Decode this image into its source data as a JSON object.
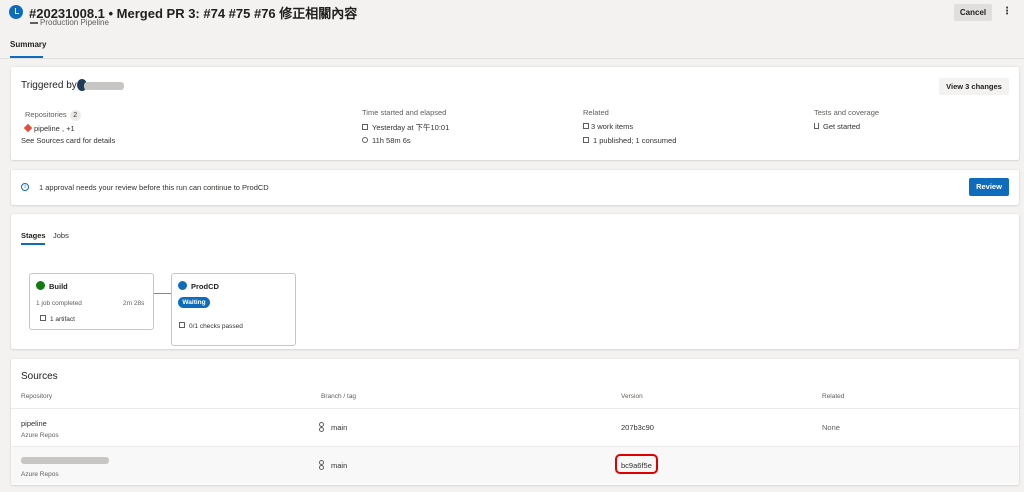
{
  "header": {
    "run_title": "#20231008.1 • Merged PR 3: #74 #75 #76 修正相關內容",
    "pipeline_name": "Production Pipeline",
    "cancel_label": "Cancel",
    "more_label": "⋮"
  },
  "tabs": {
    "summary": "Summary"
  },
  "summary_card": {
    "triggered_by_label": "Triggered by",
    "view_changes_label": "View 3 changes",
    "repositories_label": "Repositories",
    "repositories_count": "2",
    "repository_value": "pipeline",
    "repository_more": ", +1",
    "sources_link": "See Sources card for details",
    "time_label": "Time started and elapsed",
    "time_started": "Yesterday at 下午10:01",
    "elapsed": "11h 58m 6s",
    "related_label": "Related",
    "work_items": "3 work items",
    "published": "1 published; 1 consumed",
    "tests_label": "Tests and coverage",
    "get_started": "Get started"
  },
  "approval_banner": {
    "message": "1 approval needs your review before this run can continue to ProdCD",
    "review_label": "Review"
  },
  "stages_card": {
    "tab_stages": "Stages",
    "tab_jobs": "Jobs",
    "build": {
      "name": "Build",
      "jobs": "1 job completed",
      "duration": "2m 28s",
      "artifact": "1 artifact"
    },
    "prodcd": {
      "name": "ProdCD",
      "status": "Waiting",
      "checks": "0/1 checks passed"
    }
  },
  "sources_card": {
    "title": "Sources",
    "columns": [
      "Repository",
      "Branch / tag",
      "Version",
      "Related"
    ],
    "rows": [
      {
        "repo": "pipeline",
        "provider": "Azure Repos",
        "branch": "main",
        "version": "207b3c90",
        "related": "None"
      },
      {
        "repo": "",
        "provider": "Azure Repos",
        "branch": "main",
        "version": "bc9a6f5e",
        "related": ""
      }
    ]
  },
  "colors": {
    "accent": "#0f6cbd",
    "success": "#107c10",
    "highlight": "#e00000"
  }
}
